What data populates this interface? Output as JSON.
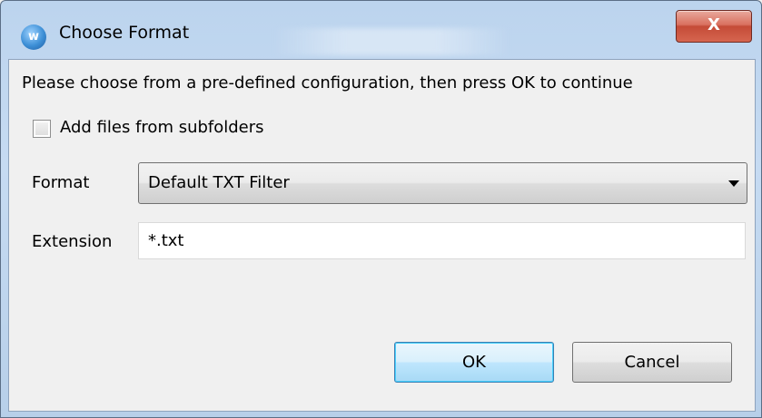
{
  "window": {
    "title": "Choose Format",
    "app_icon_letter": "w",
    "close_glyph": "X",
    "icons": {
      "app": "app-icon",
      "close": "close-icon"
    }
  },
  "dialog": {
    "message": "Please choose from a pre-defined configuration, then press OK to continue",
    "subfolders": {
      "label": "Add files from subfolders",
      "checked": false
    },
    "format": {
      "label": "Format",
      "selected": "Default TXT Filter"
    },
    "extension": {
      "label": "Extension",
      "value": "*.txt"
    },
    "buttons": {
      "ok": "OK",
      "cancel": "Cancel"
    }
  },
  "colors": {
    "title_bar": "#c6dbf2",
    "close_button": "#c44b37",
    "default_button_border": "#3c7fb1",
    "client_background": "#f0f0f0"
  }
}
